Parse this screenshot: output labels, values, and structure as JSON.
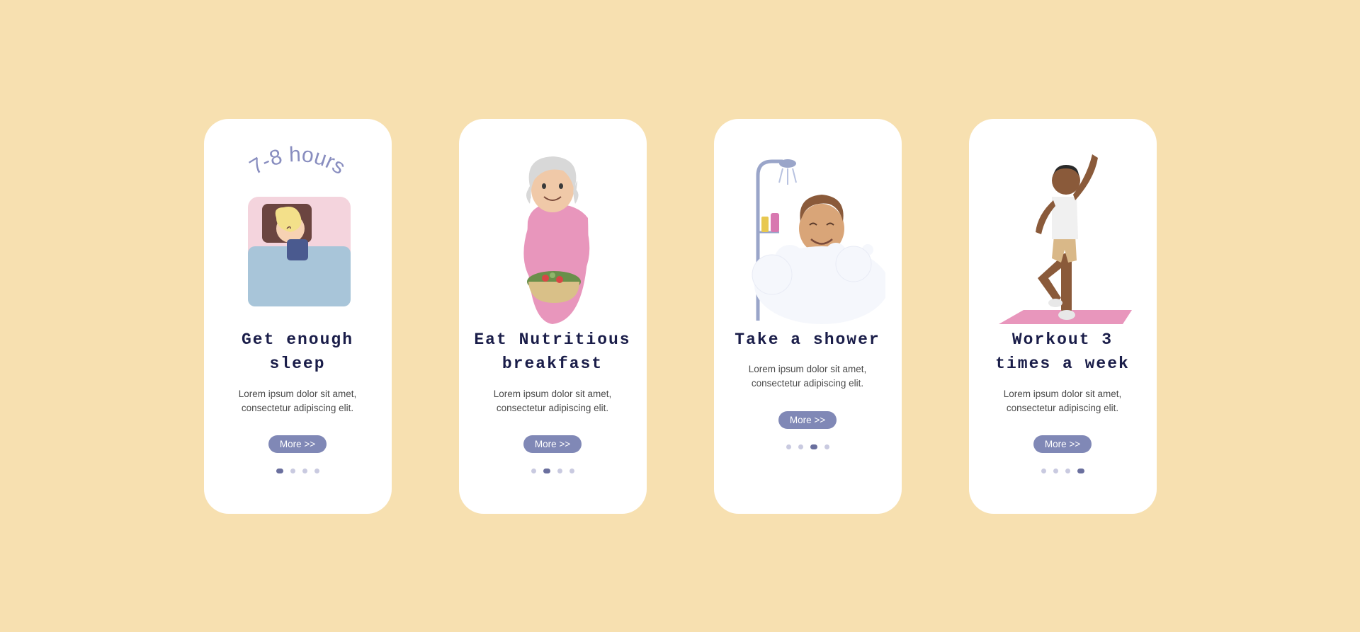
{
  "cards": [
    {
      "illustration_label": "7-8 hours",
      "illustration_name": "sleep-illustration",
      "title": "Get enough sleep",
      "description": "Lorem ipsum dolor sit amet, consectetur adipiscing elit.",
      "button_label": "More >>",
      "active_dot": 0
    },
    {
      "illustration_name": "breakfast-illustration",
      "title": "Eat Nutritious breakfast",
      "description": "Lorem ipsum dolor sit amet, consectetur adipiscing elit.",
      "button_label": "More >>",
      "active_dot": 1
    },
    {
      "illustration_name": "shower-illustration",
      "title": "Take a shower",
      "description": "Lorem ipsum dolor sit amet, consectetur adipiscing elit.",
      "button_label": "More >>",
      "active_dot": 2
    },
    {
      "illustration_name": "workout-illustration",
      "title": "Workout 3 times a week",
      "description": "Lorem ipsum dolor sit amet, consectetur adipiscing elit.",
      "button_label": "More >>",
      "active_dot": 3
    }
  ],
  "colors": {
    "background": "#f7e0b0",
    "card_bg": "#ffffff",
    "title_color": "#1a1d49",
    "button_bg": "#8088b6",
    "dot_inactive": "#c9cae0",
    "dot_active": "#6a6f9e"
  }
}
